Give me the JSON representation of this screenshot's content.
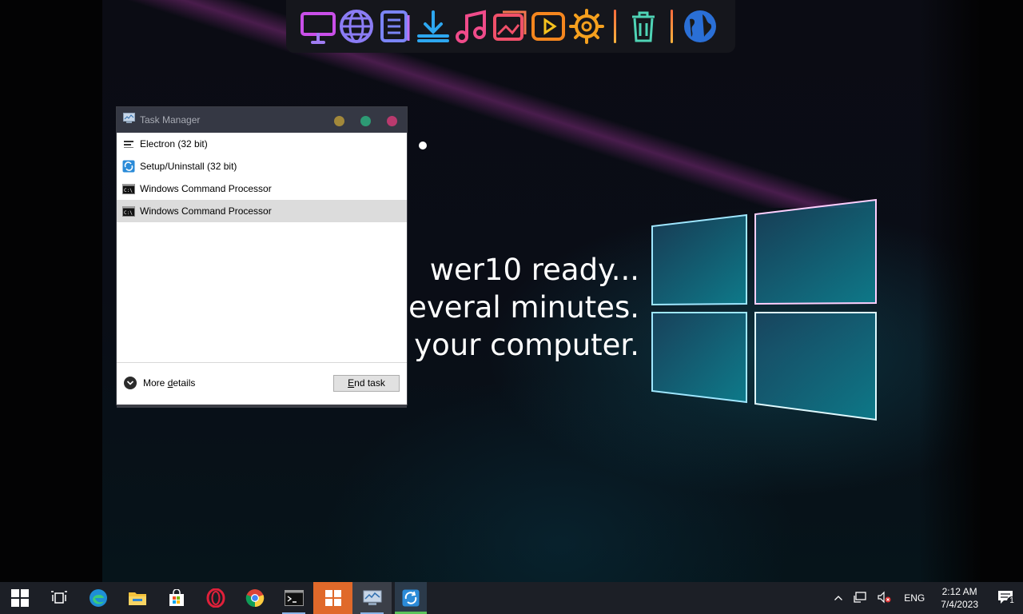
{
  "desktop": {
    "setup_text": [
      "wer10 ready...",
      "several minutes.",
      "f your computer."
    ]
  },
  "dock": {
    "icons": [
      "monitor-icon",
      "globe-icon",
      "document-list-icon",
      "download-icon",
      "music-icon",
      "picture-icon",
      "video-play-icon",
      "settings-gear-icon",
      "trash-icon",
      "world-icon"
    ]
  },
  "task_manager": {
    "title": "Task Manager",
    "processes": [
      {
        "name": "Electron (32 bit)",
        "icon": "electron-app-icon",
        "selected": false
      },
      {
        "name": "Setup/Uninstall (32 bit)",
        "icon": "setup-icon",
        "selected": false
      },
      {
        "name": "Windows Command Processor",
        "icon": "cmd-icon",
        "selected": false
      },
      {
        "name": "Windows Command Processor",
        "icon": "cmd-icon",
        "selected": true
      }
    ],
    "more_details_prefix": "More ",
    "more_details_underlined": "d",
    "more_details_suffix": "etails",
    "end_task_prefix": "",
    "end_task_underlined": "E",
    "end_task_suffix": "nd task"
  },
  "taskbar": {
    "items": [
      "start-icon",
      "task-view-icon",
      "edge-icon",
      "file-explorer-icon",
      "store-icon",
      "opera-icon",
      "chrome-icon",
      "terminal-icon",
      "windows-setup-icon",
      "task-manager-icon",
      "setup-refresh-icon"
    ],
    "tray": {
      "language": "ENG",
      "time": "2:12 AM",
      "date": "7/4/2023",
      "notification_count": "1"
    }
  },
  "colors": {
    "dock_bg": "#15161c",
    "taskbar_bg": "#1c1f26",
    "titlebar_bg": "#353844",
    "accent_orange": "#e0692a",
    "selection": "#dcdcdc"
  }
}
